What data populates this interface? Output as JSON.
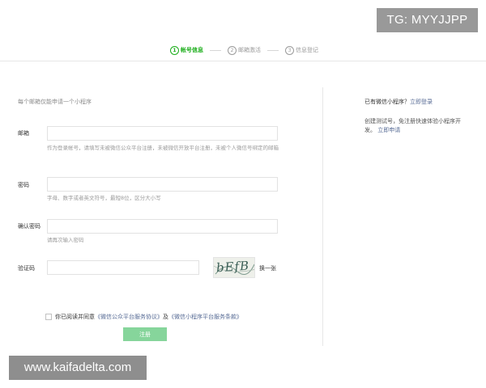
{
  "watermarks": {
    "tg": "TG: MYYJJPP",
    "site": "www.kaifadelta.com"
  },
  "steps": [
    {
      "num": "1",
      "label": "帐号信息",
      "active": true
    },
    {
      "num": "2",
      "label": "邮箱激活",
      "active": false
    },
    {
      "num": "3",
      "label": "信息登记",
      "active": false
    }
  ],
  "form": {
    "notice": "每个邮箱仅能申请一个小程序",
    "email": {
      "label": "邮箱",
      "value": "",
      "placeholder": "",
      "hint": "作为登录帐号，请填写未被微信公众平台注册，未被微信开放平台注册，未被个人微信号绑定的邮箱"
    },
    "password": {
      "label": "密码",
      "value": "",
      "placeholder": "",
      "hint": "字母、数字或者英文符号，最短8位，区分大小写"
    },
    "confirm_password": {
      "label": "确认密码",
      "value": "",
      "placeholder": "",
      "hint": "请再次输入密码"
    },
    "captcha": {
      "label": "验证码",
      "value": "",
      "placeholder": "",
      "image_text": "bEfB",
      "refresh_label": "换一张"
    },
    "agreement": {
      "prefix": "你已阅读并同意",
      "link1": "《微信公众平台服务协议》",
      "middle": "及",
      "link2": "《微信小程序平台服务条款》",
      "checked": false
    },
    "register_label": "注册"
  },
  "side": {
    "question": "已有微信小程序？",
    "login_link": "立即登录",
    "desc": "创建测试号，免注册快速体验小程序开发。",
    "apply_link": "立即申请"
  }
}
